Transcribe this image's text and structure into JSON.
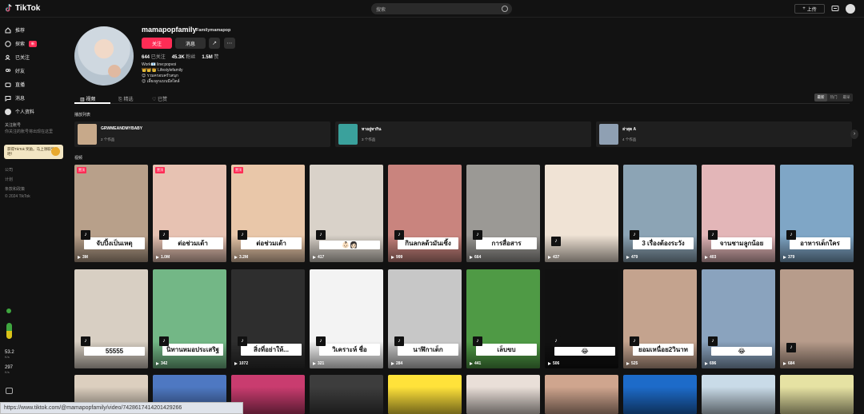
{
  "app": {
    "title": "TikTok"
  },
  "search": {
    "placeholder": "搜索"
  },
  "header": {
    "upload_label": "上传"
  },
  "sidebar": {
    "items": [
      {
        "label": "推荐",
        "icon": "home-icon"
      },
      {
        "label": "探索",
        "icon": "compass-icon",
        "badge": "新"
      },
      {
        "label": "已关注",
        "icon": "following-icon"
      },
      {
        "label": "好友",
        "icon": "friends-icon"
      },
      {
        "label": "直播",
        "icon": "live-icon"
      },
      {
        "label": "消息",
        "icon": "message-icon"
      },
      {
        "label": "个人资料",
        "icon": "profile-icon"
      }
    ],
    "following_title": "关注账号",
    "following_hint": "你关注的账号将出现在这里",
    "promo_text": "获得TikTok 奖励。马上领取奖励吧！",
    "footer_links": [
      "公司",
      "计划",
      "条款和政策"
    ],
    "copyright": "© 2024 TikTok",
    "stats": [
      {
        "value": "53.2",
        "unit": "K/s"
      },
      {
        "value": "297",
        "unit": "K/s"
      }
    ]
  },
  "profile": {
    "username": "mamapopfamily",
    "nickname": "Familymamapop",
    "follow_label": "关注",
    "message_label": "消息",
    "share_icon": "share-icon",
    "more_icon": "more-icon",
    "following_count": "644",
    "following_label": "已关注",
    "followers_count": "45.3K",
    "followers_label": "粉丝",
    "likes_count": "1.5M",
    "likes_label": "赞",
    "bio_lines": [
      "Work📧 line:popvoi",
      "👑👑👑 Lifestylefamily",
      "😊 รวมครอบครัวสนุก",
      "😊 เลี้ยงลูกแบบมีสไตล์"
    ]
  },
  "tabs": [
    {
      "label": "视频"
    },
    {
      "label": "精选"
    },
    {
      "label": "已赞"
    }
  ],
  "sort": {
    "options": [
      "最新",
      "热门",
      "最早"
    ],
    "selected": "最新"
  },
  "sections": {
    "playlists": "播放列表",
    "videos": "视频"
  },
  "playlists": [
    {
      "title": "GRWMEANDMYBABY",
      "count": "2 个作品",
      "color": "#c7a98a"
    },
    {
      "title": "หาอยู่หากิน",
      "count": "3 个作品",
      "color": "#3aa19c"
    },
    {
      "title": "ล่าสุด A",
      "count": "4 个作品",
      "color": "#8fa0b3"
    }
  ],
  "videos": [
    {
      "caption": "จับปิ้งเป็นเหตุ",
      "views": "3M",
      "pin": "置顶",
      "color": "#b8a08a"
    },
    {
      "caption": "ต่อช่วมเต้า",
      "views": "1.0M",
      "pin": "置顶",
      "color": "#e7c2b2"
    },
    {
      "caption": "ต่อช่วมเต้า",
      "views": "3.2M",
      "pin": "置顶",
      "color": "#e9c7a9"
    },
    {
      "caption": "👶🏻👩🏻",
      "views": "417",
      "color": "#d9d2c9"
    },
    {
      "caption": "กินลกลด้วมันเซิ้ง",
      "views": "999",
      "color": "#c9847e"
    },
    {
      "caption": "การสื่อสาร",
      "views": "664",
      "color": "#9b9995"
    },
    {
      "caption": "",
      "views": "437",
      "color": "#f0e3d5"
    },
    {
      "caption": "3 เรื่องต้องระวัง",
      "views": "479",
      "color": "#8ca4b5"
    },
    {
      "caption": "จานชามลูกน้อย",
      "views": "403",
      "color": "#e3b6b8"
    },
    {
      "caption": "อาหารเด็กใคร",
      "views": "379",
      "color": "#7fa6c6"
    },
    {
      "caption": "55555",
      "views": "",
      "color": "#d8cfc3"
    },
    {
      "caption": "นิทานหมอประเสริฐ",
      "views": "342",
      "color": "#73b786"
    },
    {
      "caption": "สิ่งที่อย่าให้...",
      "views": "1072",
      "color": "#2e2e2e"
    },
    {
      "caption": "วิเคราะห์ ชื่อ",
      "views": "321",
      "color": "#f3f3f3"
    },
    {
      "caption": "นาฬิกาเด็ก",
      "views": "284",
      "color": "#c7c7c7"
    },
    {
      "caption": "เล็บขบ",
      "views": "441",
      "color": "#4f9a45"
    },
    {
      "caption": "😂",
      "views": "506",
      "color": "#111111"
    },
    {
      "caption": "ยอมเหนื่อย2วินาท",
      "views": "525",
      "color": "#c4a38e"
    },
    {
      "caption": "😂",
      "views": "696",
      "color": "#8aa3be"
    },
    {
      "caption": "",
      "views": "684",
      "color": "#b79c8b"
    },
    {
      "caption": "",
      "views": "",
      "color": "#dccfbf"
    },
    {
      "caption": "",
      "views": "",
      "color": "#4e78c2"
    },
    {
      "caption": "",
      "views": "",
      "color": "#c93c6f"
    },
    {
      "caption": "",
      "views": "",
      "color": "#3d3d3d"
    },
    {
      "caption": "",
      "views": "",
      "color": "#ffe23a"
    },
    {
      "caption": "",
      "views": "",
      "color": "#e9dfd8"
    },
    {
      "caption": "",
      "views": "",
      "color": "#cfa58e"
    },
    {
      "caption": "",
      "views": "",
      "color": "#1d6bc9"
    },
    {
      "caption": "",
      "views": "",
      "color": "#c9dbe8"
    },
    {
      "caption": "",
      "views": "",
      "color": "#e6e2a3"
    }
  ],
  "status_url": "https://www.tiktok.com/@mamapopfamily/video/7428617414201429266"
}
